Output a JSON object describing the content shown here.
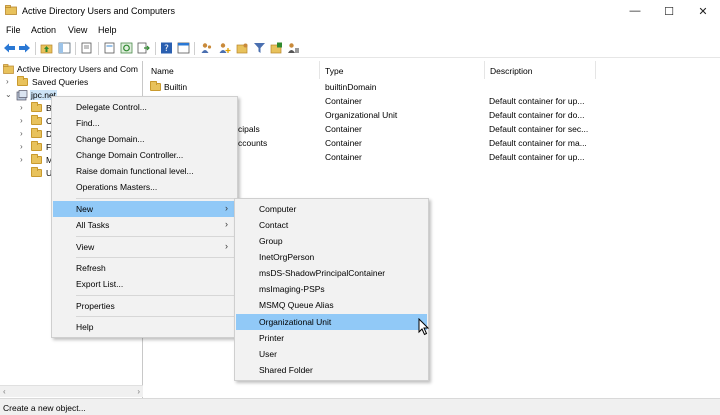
{
  "window": {
    "title": "Active Directory Users and Computers",
    "controls": {
      "minimize": "—",
      "maximize": "☐",
      "close": "✕"
    }
  },
  "menubar": {
    "items": [
      "File",
      "Action",
      "View",
      "Help"
    ]
  },
  "toolbar": {
    "buttons": [
      "back-icon",
      "forward-icon",
      "up-folder-icon",
      "console-tree-icon",
      "properties-icon",
      "export-icon",
      "refresh-icon",
      "export-list-icon",
      "help-icon",
      "console-icon",
      "users-icon",
      "add-user-icon",
      "add-group-icon",
      "filter-icon",
      "new-ou-icon",
      "delegate-icon"
    ]
  },
  "tree": {
    "items": [
      {
        "label": "Active Directory Users and Com",
        "icon": "ad-console-icon"
      },
      {
        "label": "Saved Queries",
        "icon": "folder-icon"
      },
      {
        "label": "jpc.net",
        "icon": "domain-icon"
      },
      {
        "label": "B",
        "icon": "folder-icon"
      },
      {
        "label": "C",
        "icon": "folder-icon"
      },
      {
        "label": "D",
        "icon": "folder-icon"
      },
      {
        "label": "F",
        "icon": "folder-icon"
      },
      {
        "label": "M",
        "icon": "folder-icon"
      },
      {
        "label": "U",
        "icon": "folder-icon"
      }
    ]
  },
  "list": {
    "columns": [
      "Name",
      "Type",
      "Description"
    ],
    "rows": [
      {
        "name": "Builtin",
        "type": "builtinDomain",
        "description": ""
      },
      {
        "name": "",
        "type": "Container",
        "description": "Default container for up..."
      },
      {
        "name": "",
        "type": "Organizational Unit",
        "description": "Default container for do..."
      },
      {
        "name": "cipals",
        "type": "Container",
        "description": "Default container for sec..."
      },
      {
        "name": "ccounts",
        "type": "Container",
        "description": "Default container for ma..."
      },
      {
        "name": "",
        "type": "Container",
        "description": "Default container for up..."
      }
    ]
  },
  "context_menu": {
    "items": [
      "Delegate Control...",
      "Find...",
      "Change Domain...",
      "Change Domain Controller...",
      "Raise domain functional level...",
      "Operations Masters...",
      "New",
      "All Tasks",
      "View",
      "Refresh",
      "Export List...",
      "Properties",
      "Help"
    ],
    "highlighted": "New"
  },
  "submenu": {
    "items": [
      "Computer",
      "Contact",
      "Group",
      "InetOrgPerson",
      "msDS-ShadowPrincipalContainer",
      "msImaging-PSPs",
      "MSMQ Queue Alias",
      "Organizational Unit",
      "Printer",
      "User",
      "Shared Folder"
    ],
    "highlighted": "Organizational Unit"
  },
  "status": {
    "text": "Create a new object..."
  },
  "colors": {
    "highlight": "#91c9f7",
    "selection": "#cce4f7",
    "folder": "#e8c25c"
  }
}
